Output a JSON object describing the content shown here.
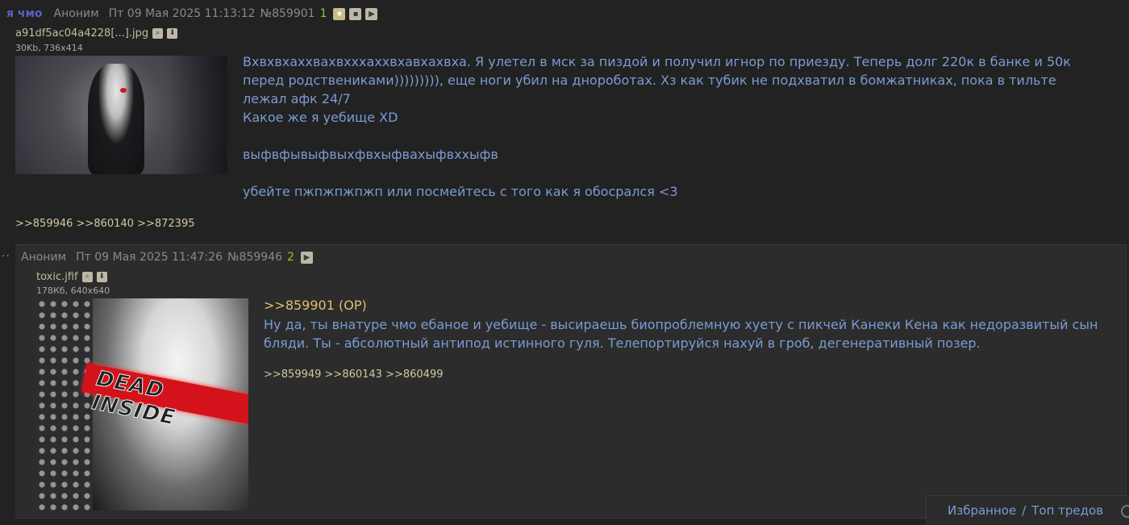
{
  "op": {
    "subject": "я чмо",
    "name": "Аноним",
    "date": "Пт 09 Мая 2025 11:13:12",
    "number": "№859901",
    "reply_count": "1",
    "file": {
      "name": "a91df5ac04a4228[...].jpg",
      "meta": "30Kb, 736x414"
    },
    "text": [
      "Вхвхвхаххвахвхххаххвхавхахвха. Я улетел в мск за пиздой и получил игнор по приезду. Теперь долг 220к в банке и 50к перед родствениками))))))))), еще ноги убил на днороботах. Хз как тубик не подхватил в бомжатниках, пока в тильте лежал афк 24/7",
      "Какое же я уебище XD",
      "",
      "выфвфывыфвыхфвхыфвахыфвххыфв",
      "",
      "убейте пжпжпжпжп или посмейтесь с того как я обосрался <3"
    ],
    "refs": ">>859946 >>860140 >>872395"
  },
  "reply": {
    "name": "Аноним",
    "date": "Пт 09 Мая 2025 11:47:26",
    "number": "№859946",
    "reply_count": "2",
    "file": {
      "name": "toxic.jfif",
      "meta": "178Кб, 640x640",
      "overlay_text": "DEAD INSIDE"
    },
    "quote": ">>859901 (OP)",
    "text": "Ну да, ты внатуре чмо ебаное и уебище - высираешь биопроблемную хуету с пикчей Канеки Кена как недоразвитый сын бляди. Ты - абсолютный антипод истинного гуля. Телепортируйся нахуй в гроб, дегенеративный позер.",
    "refs": ">>859949 >>860143 >>860499"
  },
  "bottom_bar": {
    "favorites": "Избранное",
    "separator": "/",
    "top_threads": "Топ тредов"
  },
  "colors": {
    "background": "#222222",
    "post_text": "#7b9bd3",
    "subject": "#5a60c8",
    "refs": "#d2c89f",
    "quote": "#e0bf6e",
    "count": "#9fc12b"
  }
}
